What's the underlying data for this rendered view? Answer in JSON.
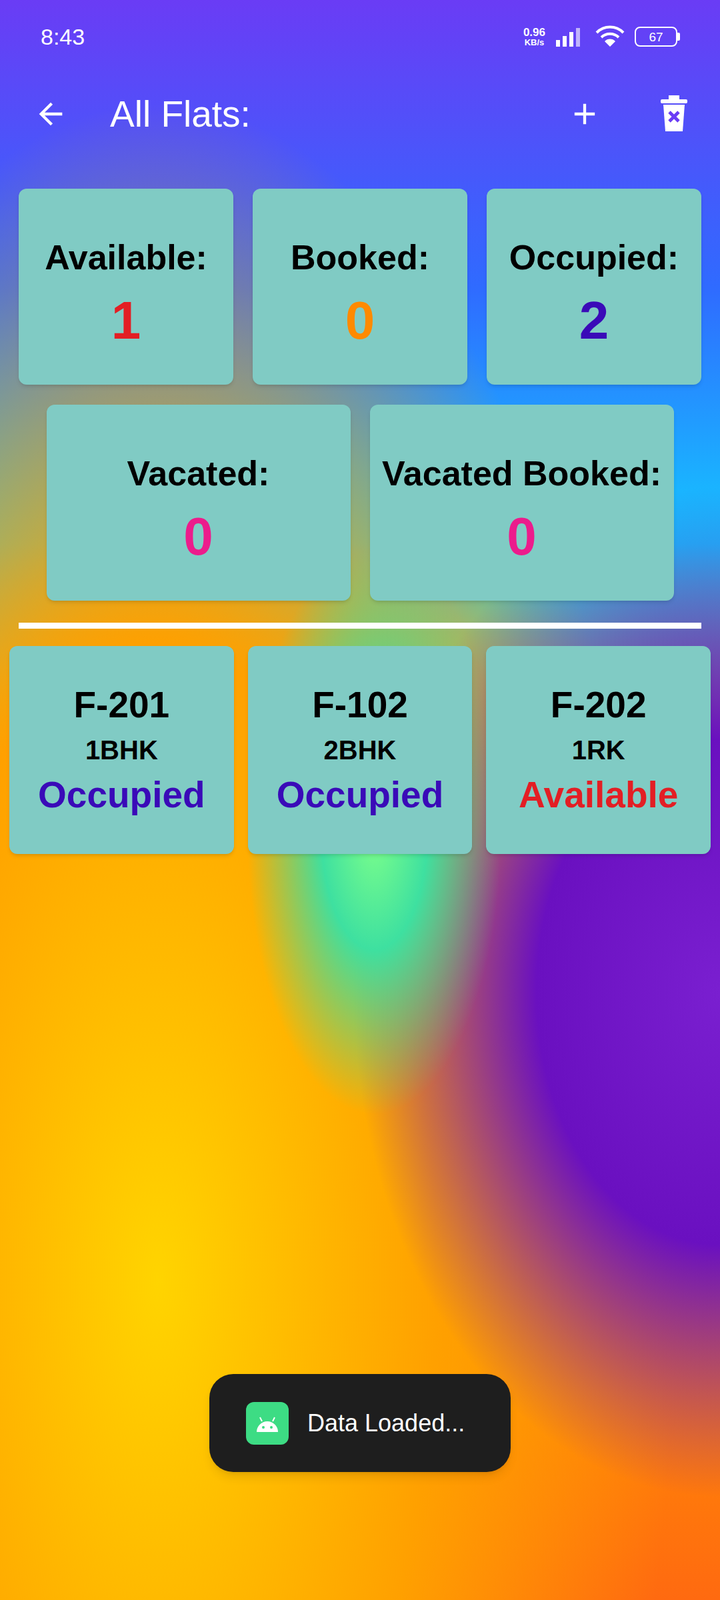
{
  "status_bar": {
    "time": "8:43",
    "speed": "0.96",
    "speed_unit": "KB/s",
    "battery": "67"
  },
  "app_bar": {
    "title": "All Flats:"
  },
  "summary": [
    {
      "label": "Available:",
      "count": "1",
      "color": "#e31e24"
    },
    {
      "label": "Booked:",
      "count": "0",
      "color": "#ff8a00"
    },
    {
      "label": "Occupied:",
      "count": "2",
      "color": "#3a0ab8"
    },
    {
      "label": "Vacated:",
      "count": "0",
      "color": "#ec1c8c"
    },
    {
      "label": "Vacated Booked:",
      "count": "0",
      "color": "#ec1c8c"
    }
  ],
  "flats": [
    {
      "name": "F-201",
      "type": "1BHK",
      "status": "Occupied",
      "color": "#3a0ab8"
    },
    {
      "name": "F-102",
      "type": "2BHK",
      "status": "Occupied",
      "color": "#3a0ab8"
    },
    {
      "name": "F-202",
      "type": "1RK",
      "status": "Available",
      "color": "#e31e24"
    }
  ],
  "toast": {
    "text": "Data Loaded..."
  }
}
